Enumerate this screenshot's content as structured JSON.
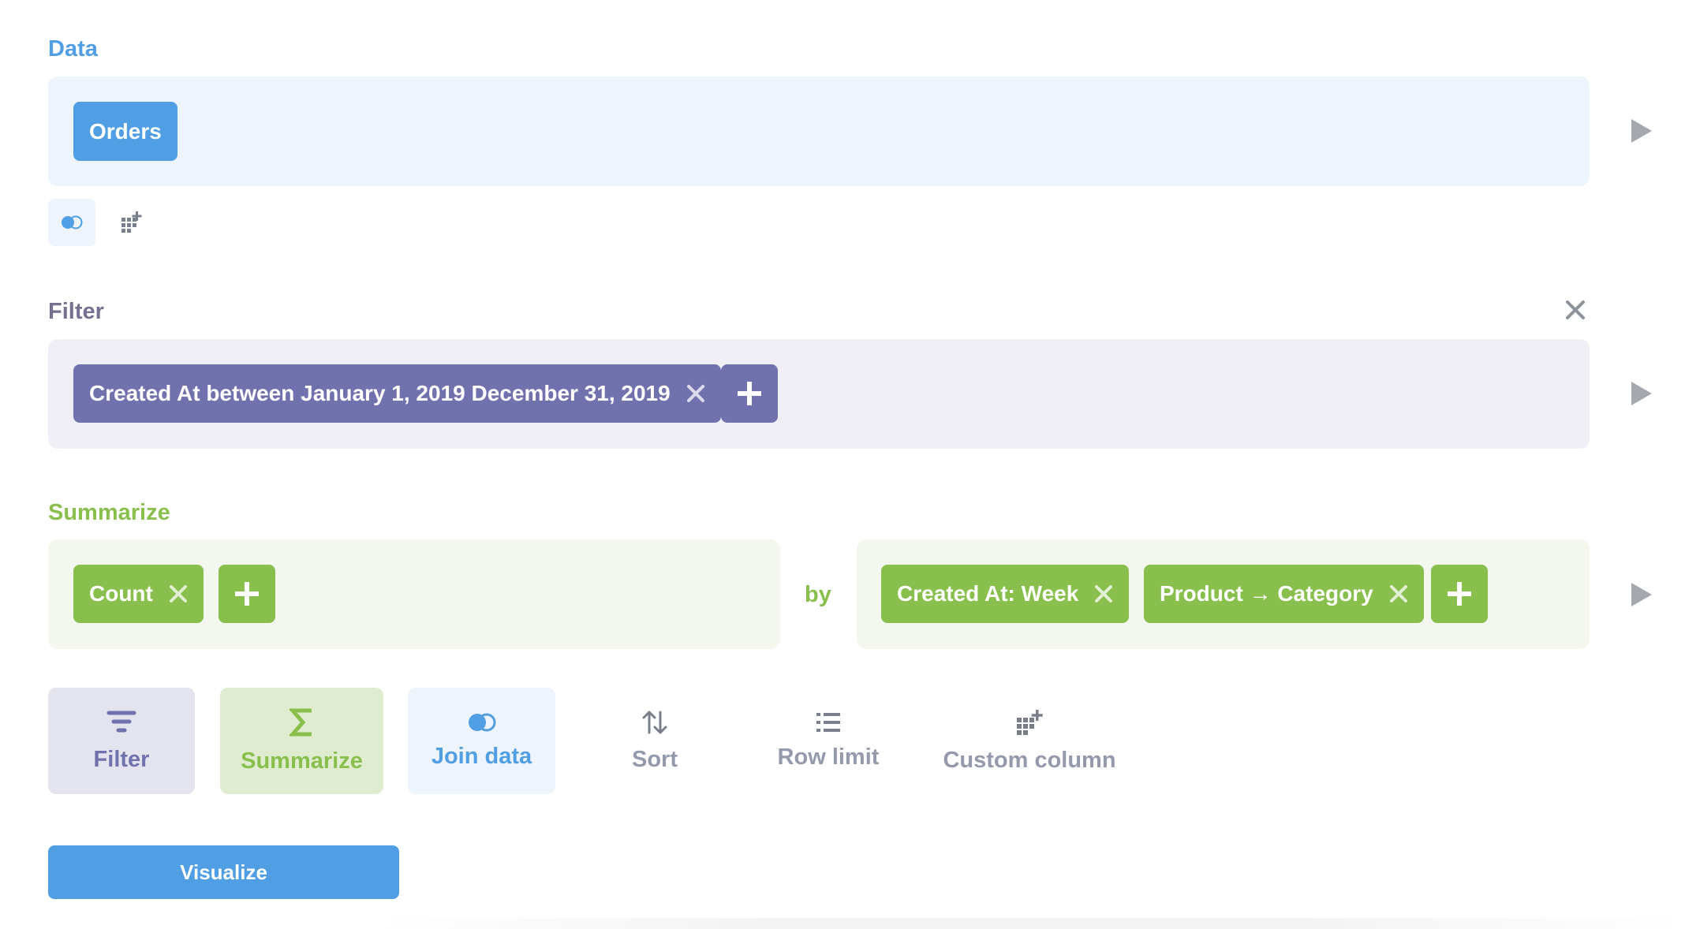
{
  "data_section": {
    "title": "Data",
    "table_pill": "Orders",
    "join_icon": "join-icon",
    "custom_column_icon": "custom-column-icon"
  },
  "filter_section": {
    "title": "Filter",
    "filter_pill": "Created At between January 1, 2019 December 31, 2019",
    "remove_icon": "close-icon",
    "add_icon": "plus-icon"
  },
  "summarize_section": {
    "title": "Summarize",
    "metric_pill": "Count",
    "by_label": "by",
    "breakouts": [
      "Created At: Week",
      "Product → Category"
    ]
  },
  "actions": [
    {
      "label": "Filter",
      "icon": "filter-icon",
      "color": "#7172ad"
    },
    {
      "label": "Summarize",
      "icon": "sigma-icon",
      "color": "#88bf4d"
    },
    {
      "label": "Join data",
      "icon": "join-icon",
      "color": "#509ee3"
    },
    {
      "label": "Sort",
      "icon": "sort-icon",
      "color": "#949aab"
    },
    {
      "label": "Row limit",
      "icon": "list-icon",
      "color": "#949aab"
    },
    {
      "label": "Custom column",
      "icon": "custom-column-icon",
      "color": "#949aab"
    }
  ],
  "visualize_button": "Visualize",
  "colors": {
    "data": "#509ee3",
    "filter": "#7172ad",
    "summarize": "#88bf4d",
    "muted": "#949aab"
  }
}
